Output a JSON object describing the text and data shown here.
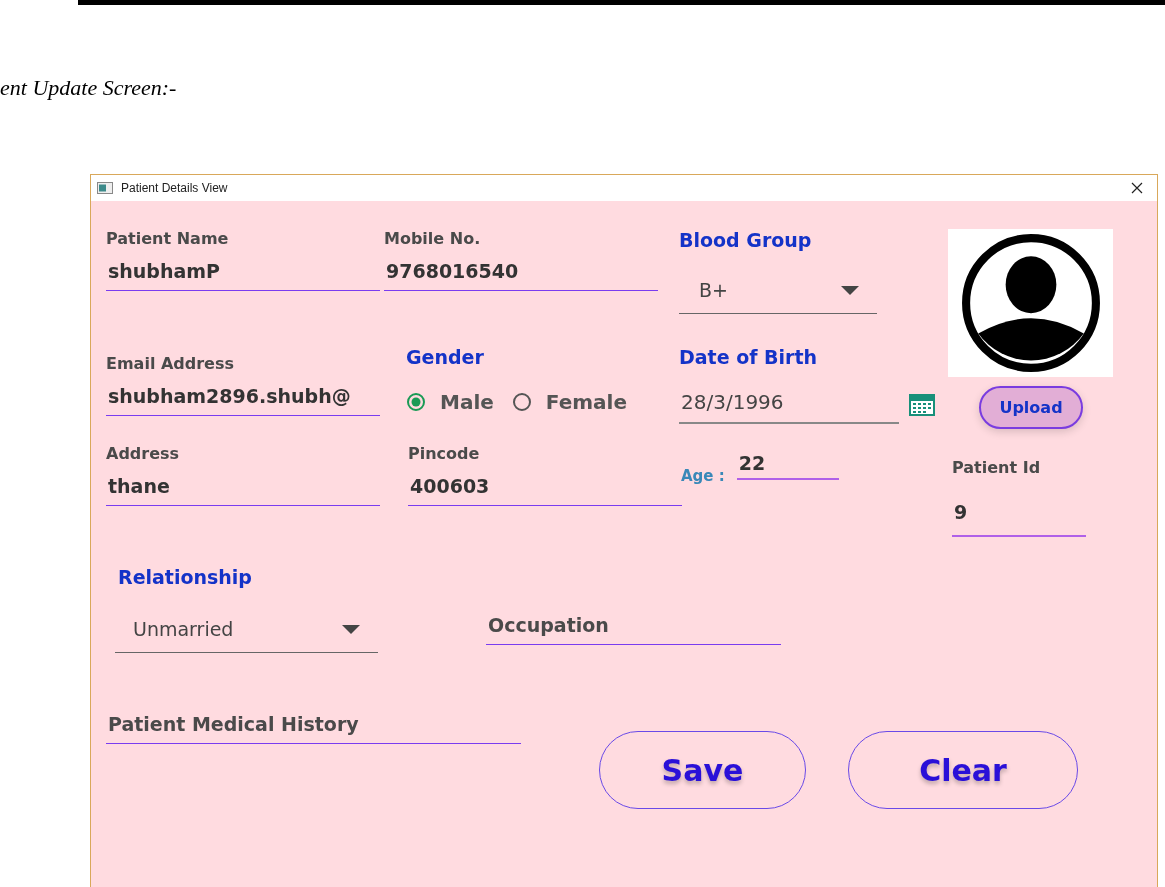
{
  "caption": "ent Update Screen:-",
  "window": {
    "title": "Patient Details View"
  },
  "patient_name": {
    "label": "Patient Name",
    "value": "shubhamP"
  },
  "mobile": {
    "label": "Mobile No.",
    "value": "9768016540"
  },
  "blood_group": {
    "label": "Blood Group",
    "value": "B+"
  },
  "upload_button": "Upload",
  "email": {
    "label": "Email Address",
    "value": "shubham2896.shubh@"
  },
  "gender": {
    "label": "Gender",
    "options": [
      {
        "label": "Male",
        "selected": true
      },
      {
        "label": "Female",
        "selected": false
      }
    ]
  },
  "date_of_birth": {
    "label": "Date of Birth",
    "value": "28/3/1996"
  },
  "address": {
    "label": "Address",
    "value": "thane"
  },
  "pincode": {
    "label": "Pincode",
    "value": "400603"
  },
  "age": {
    "label": "Age :",
    "value": "22"
  },
  "patient_id": {
    "label": "Patient Id",
    "value": "9"
  },
  "relationship": {
    "label": "Relationship",
    "value": "Unmarried"
  },
  "occupation": {
    "placeholder": "Occupation"
  },
  "medical_history": {
    "placeholder": "Patient Medical History"
  },
  "buttons": [
    "Save",
    "Clear"
  ]
}
